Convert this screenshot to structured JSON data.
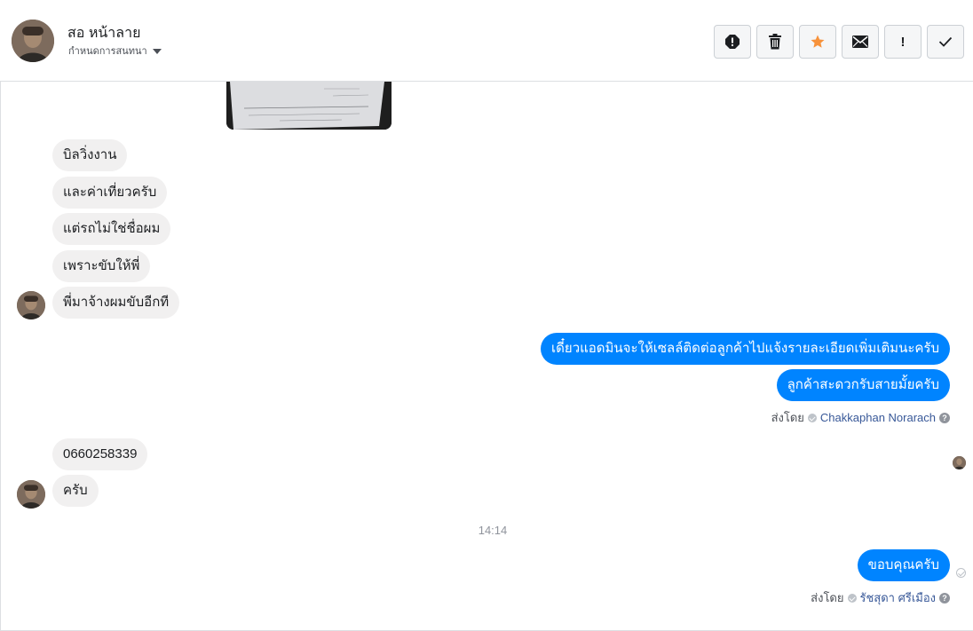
{
  "header": {
    "contact_name": "สอ หน้าลาย",
    "assign_label": "กำหนดการสนทนา",
    "toolbar": [
      {
        "name": "alert-circle-button",
        "icon": "alert-circle-icon"
      },
      {
        "name": "delete-button",
        "icon": "trash-icon"
      },
      {
        "name": "star-button",
        "icon": "star-icon",
        "color": "#f7923b"
      },
      {
        "name": "mark-unread-button",
        "icon": "envelope-icon"
      },
      {
        "name": "follow-up-button",
        "icon": "exclamation-icon",
        "label": "!"
      },
      {
        "name": "mark-done-button",
        "icon": "check-icon"
      }
    ]
  },
  "messages": {
    "incoming_group_1": [
      "บิลวิ่งงาน",
      "และค่าเที่ยวครับ",
      "แต่รถไม่ใช่ชื่อผม",
      "เพราะขับให้พี่",
      "พี่มาจ้างผมขับอีกที"
    ],
    "outgoing_group_1": [
      "เดี๋ยวแอดมินจะให้เซลล์ติดต่อลูกค้าไปแจ้งรายละเอียดเพิ่มเติมนะครับ",
      "ลูกค้าสะดวกรับสายมั้ยครับ"
    ],
    "sent_by_1": {
      "prefix": "ส่งโดย",
      "agent": "Chakkaphan Norarach"
    },
    "incoming_group_2": [
      "0660258339",
      "ครับ"
    ],
    "timestamp": "14:14",
    "outgoing_group_2": [
      "ขอบคุณครับ"
    ],
    "sent_by_2": {
      "prefix": "ส่งโดย",
      "agent": "รัชสุดา ศรีเมือง"
    }
  },
  "colors": {
    "outgoing_bubble": "#0084ff",
    "incoming_bubble": "#f1f0f0",
    "star": "#f7923b"
  }
}
